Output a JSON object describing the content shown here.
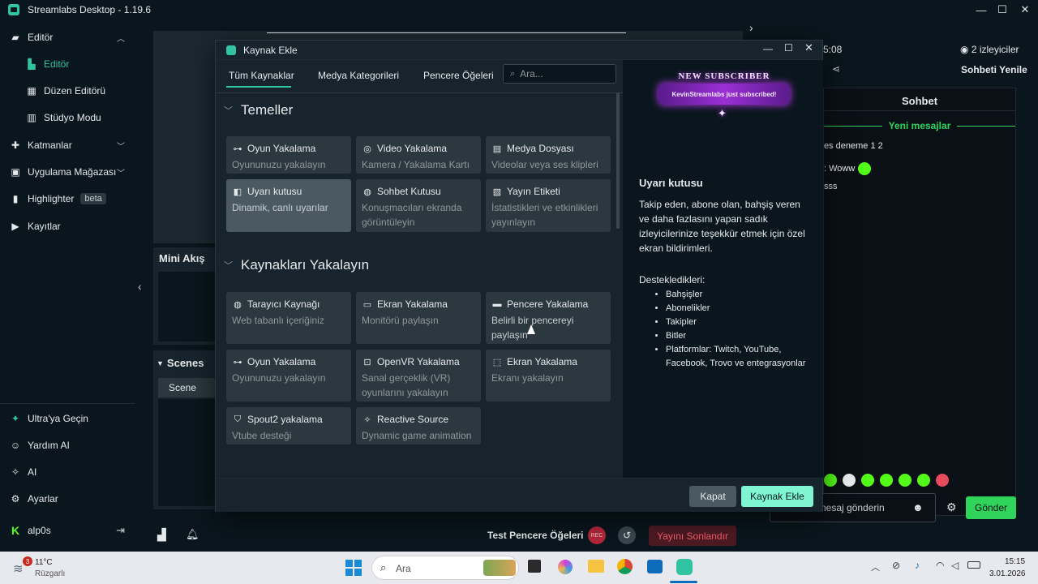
{
  "window": {
    "title": "Streamlabs Desktop - 1.19.6"
  },
  "sidebar": {
    "items": [
      {
        "label": "Editör",
        "icon": "video-camera-icon"
      },
      {
        "label": "Editör",
        "icon": "editor-icon"
      },
      {
        "label": "Düzen Editörü",
        "icon": "grid-icon"
      },
      {
        "label": "Stüdyo Modu",
        "icon": "studio-icon"
      },
      {
        "label": "Katmanlar",
        "icon": "puzzle-icon"
      },
      {
        "label": "Uygulama Mağazası",
        "icon": "store-icon"
      },
      {
        "label": "Highlighter",
        "icon": "highlighter-icon",
        "badge": "beta"
      },
      {
        "label": "Kayıtlar",
        "icon": "play-icon"
      }
    ],
    "bottom": [
      {
        "label": "Ultra'ya Geçin",
        "icon": "ultra-icon"
      },
      {
        "label": "Yardım AI",
        "icon": "help-ai-icon"
      },
      {
        "label": "AI",
        "icon": "sparkle-icon"
      },
      {
        "label": "Ayarlar",
        "icon": "gear-icon"
      },
      {
        "label": "alp0s",
        "icon": "kick-logo-icon"
      }
    ]
  },
  "editor": {
    "mini_feed": "Mini Akış",
    "scenes_title": "Scenes",
    "scene_item": "Scene",
    "test_widgets": "Test Pencere Öğeleri",
    "rec_label": "REC",
    "end_stream": "Yayını Sonlandır"
  },
  "chat": {
    "time_partial": "5:08",
    "viewers": "2 izleyiciler",
    "refresh": "Sohbeti Yenile",
    "tab": "Sohbet",
    "new_messages": "Yeni mesajlar",
    "messages": [
      "es deneme 1 2",
      ": Woww",
      "sss"
    ],
    "input_placeholder": "nesaj gönderin",
    "send": "Gönder"
  },
  "modal": {
    "title": "Kaynak Ekle",
    "tabs": [
      "Tüm Kaynaklar",
      "Medya Kategorileri",
      "Pencere Öğeleri"
    ],
    "search_placeholder": "Ara...",
    "sections": [
      {
        "title": "Temeller",
        "cards": [
          {
            "name": "Oyun Yakalama",
            "desc": "Oyununuzu yakalayın",
            "icon": "gamepad-icon"
          },
          {
            "name": "Video Yakalama",
            "desc": "Kamera / Yakalama Kartı",
            "icon": "webcam-icon"
          },
          {
            "name": "Medya Dosyası",
            "desc": "Videolar veya ses klipleri",
            "icon": "file-icon"
          },
          {
            "name": "Uyarı kutusu",
            "desc": "Dinamik, canlı uyarılar",
            "icon": "alert-box-icon",
            "selected": true
          },
          {
            "name": "Sohbet Kutusu",
            "desc": "Konuşmacıları ekranda görüntüleyin",
            "icon": "chat-icon"
          },
          {
            "name": "Yayın Etiketi",
            "desc": "İstatistikleri ve etkinlikleri yayınlayın",
            "icon": "label-icon"
          }
        ]
      },
      {
        "title": "Kaynakları Yakalayın",
        "cards": [
          {
            "name": "Tarayıcı Kaynağı",
            "desc": "Web tabanlı içeriğiniz",
            "icon": "globe-icon"
          },
          {
            "name": "Ekran Yakalama",
            "desc": "Monitörü paylaşın",
            "icon": "monitor-icon"
          },
          {
            "name": "Pencere Yakalama",
            "desc": "Belirli bir pencereyi paylaşın",
            "icon": "window-icon",
            "hover": true
          },
          {
            "name": "Oyun Yakalama",
            "desc": "Oyununuzu yakalayın",
            "icon": "gamepad-icon"
          },
          {
            "name": "OpenVR Yakalama",
            "desc": "Sanal gerçeklik (VR) oyunlarını yakalayın",
            "icon": "vr-icon"
          },
          {
            "name": "Ekran Yakalama",
            "desc": "Ekranı yakalayın",
            "icon": "dashed-square-icon"
          },
          {
            "name": "Spout2 yakalama",
            "desc": "Vtube desteği",
            "icon": "shield-icon"
          },
          {
            "name": "Reactive Source",
            "desc": "Dynamic game animation",
            "icon": "sparkle-icon"
          }
        ]
      }
    ],
    "preview": {
      "banner_top": "NEW SUBSCRIBER",
      "banner_text": "KevinStreamlabs just subscribed!",
      "title": "Uyarı kutusu",
      "description": "Takip eden, abone olan, bahşiş veren ve daha fazlasını yapan sadık izleyicilerinize teşekkür etmek için özel ekran bildirimleri.",
      "supported_label": "Destekledikleri:",
      "supported": [
        "Bahşişler",
        "Abonelikler",
        "Takipler",
        "Bitler",
        "Platformlar: Twitch, YouTube, Facebook, Trovo ve entegrasyonlar"
      ]
    },
    "close_button": "Kapat",
    "add_button": "Kaynak Ekle"
  },
  "taskbar": {
    "weather_temp": "11°C",
    "weather_desc": "Rüzgarlı",
    "notification_count": "3",
    "search_placeholder": "Ara",
    "time": "15:15",
    "date": "3.01.2026"
  },
  "colors": {
    "accent": "#31c3a2",
    "background": "#09161d",
    "panel": "#17242d",
    "card": "#2b383f",
    "danger": "#b1283a",
    "send": "#31d45a"
  }
}
